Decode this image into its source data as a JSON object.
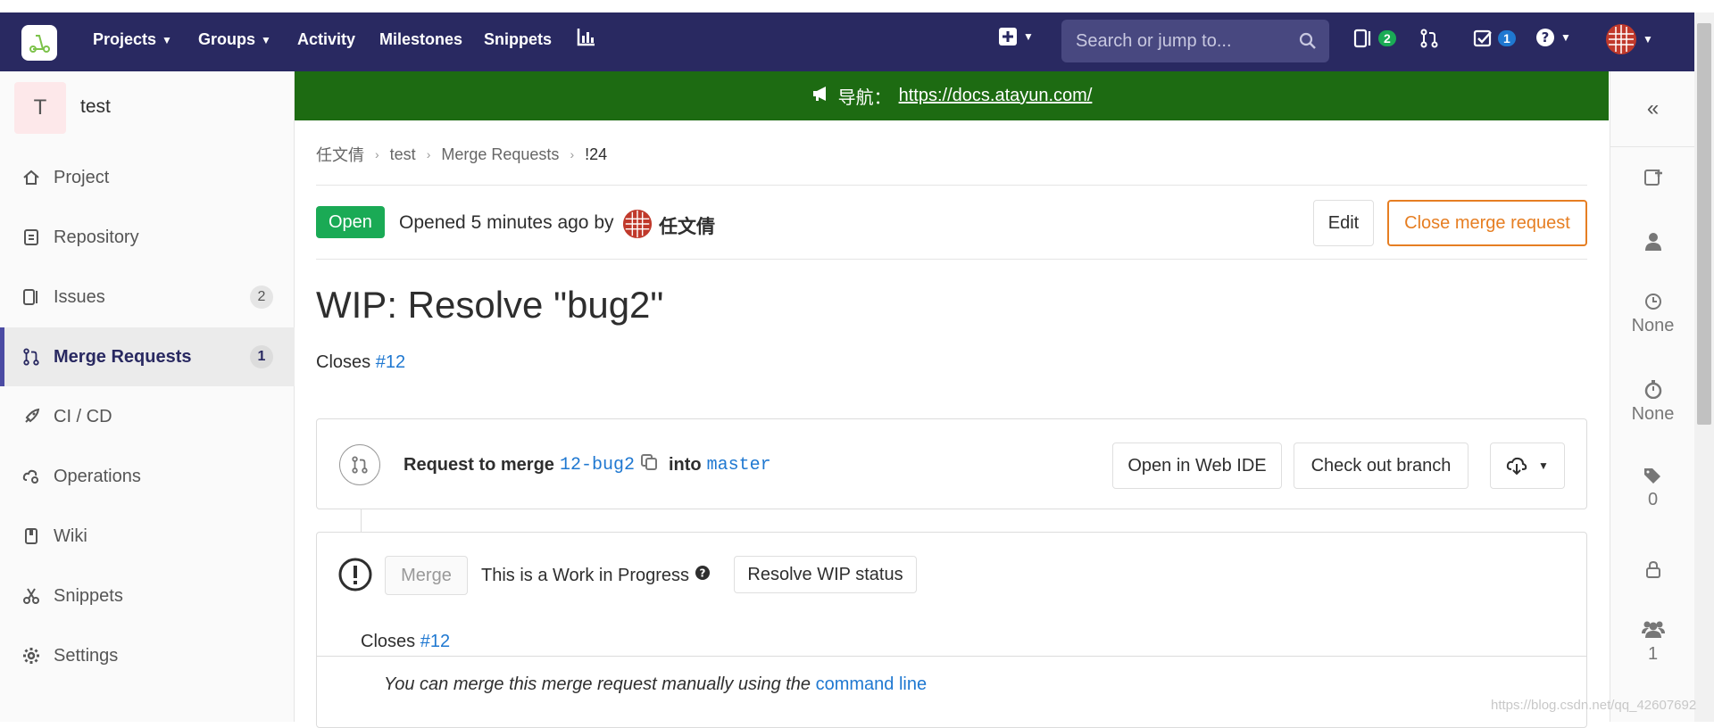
{
  "nav": {
    "projects": "Projects",
    "groups": "Groups",
    "activity": "Activity",
    "milestones": "Milestones",
    "snippets": "Snippets",
    "search_placeholder": "Search or jump to...",
    "issues_count": "2",
    "todos_count": "1"
  },
  "sidebar": {
    "avatar_letter": "T",
    "project_name": "test",
    "items": [
      {
        "label": "Project",
        "count": ""
      },
      {
        "label": "Repository",
        "count": ""
      },
      {
        "label": "Issues",
        "count": "2"
      },
      {
        "label": "Merge Requests",
        "count": "1"
      },
      {
        "label": "CI / CD",
        "count": ""
      },
      {
        "label": "Operations",
        "count": ""
      },
      {
        "label": "Wiki",
        "count": ""
      },
      {
        "label": "Snippets",
        "count": ""
      },
      {
        "label": "Settings",
        "count": ""
      }
    ]
  },
  "banner": {
    "prefix": "导航：",
    "url": "https://docs.atayun.com/"
  },
  "breadcrumb": [
    "任文倩",
    "test",
    "Merge Requests",
    "!24"
  ],
  "mr": {
    "status": "Open",
    "opened_text": "Opened 5 minutes ago by",
    "author": "任文倩",
    "edit": "Edit",
    "close": "Close merge request",
    "title": "WIP: Resolve \"bug2\"",
    "closes_label": "Closes",
    "closes_ref": "#12",
    "request_to_merge": "Request to merge",
    "source_branch": "12-bug2",
    "into": "into",
    "target_branch": "master",
    "open_web_ide": "Open in Web IDE",
    "check_out_branch": "Check out branch",
    "merge_button": "Merge",
    "wip_text": "This is a Work in Progress",
    "resolve_wip": "Resolve WIP status",
    "widget_closes_label": "Closes",
    "widget_closes_ref": "#12",
    "manual_merge_text": "You can merge this merge request manually using the",
    "command_line": "command line"
  },
  "rightbar": {
    "milestone": "None",
    "time": "None",
    "labels": "0",
    "participants": "1"
  },
  "watermark": "https://blog.csdn.net/qq_42607692",
  "colors": {
    "nav_bg": "#292961",
    "banner_bg": "#1d6b12",
    "open_badge": "#1aaa55",
    "close_btn": "#e67e22",
    "link": "#1f78d1"
  }
}
